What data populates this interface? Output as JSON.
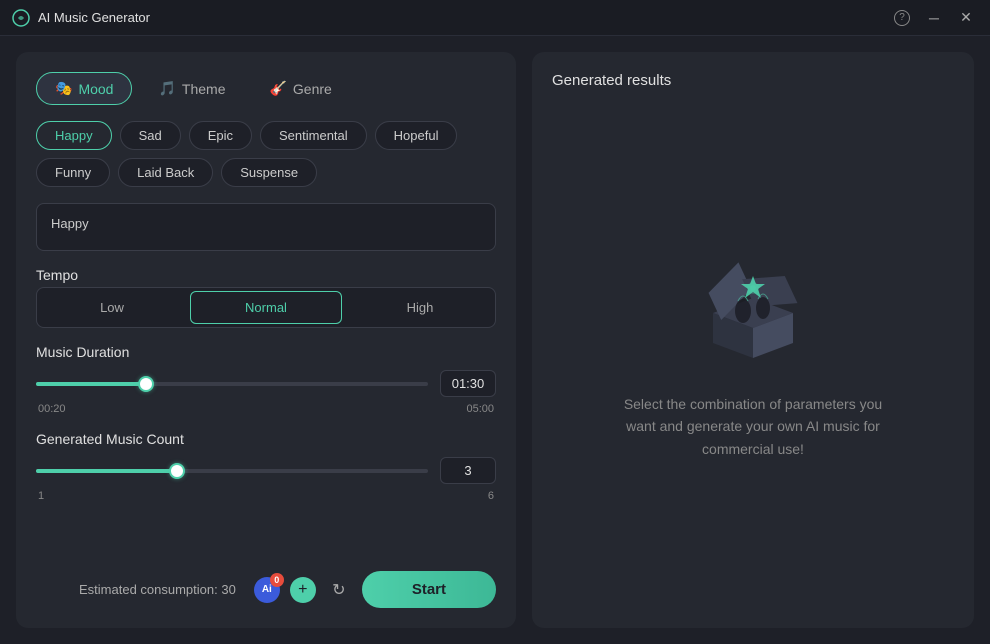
{
  "titlebar": {
    "title": "AI Music Generator",
    "help_label": "?",
    "minimize_icon": "─",
    "close_icon": "✕"
  },
  "tabs": [
    {
      "id": "mood",
      "label": "Mood",
      "icon": "🎭",
      "active": true
    },
    {
      "id": "theme",
      "label": "Theme",
      "icon": "🎵",
      "active": false
    },
    {
      "id": "genre",
      "label": "Genre",
      "icon": "🎸",
      "active": false
    }
  ],
  "moods": [
    {
      "id": "happy",
      "label": "Happy",
      "selected": true
    },
    {
      "id": "sad",
      "label": "Sad",
      "selected": false
    },
    {
      "id": "epic",
      "label": "Epic",
      "selected": false
    },
    {
      "id": "sentimental",
      "label": "Sentimental",
      "selected": false
    },
    {
      "id": "hopeful",
      "label": "Hopeful",
      "selected": false
    },
    {
      "id": "funny",
      "label": "Funny",
      "selected": false
    },
    {
      "id": "laid-back",
      "label": "Laid Back",
      "selected": false
    },
    {
      "id": "suspense",
      "label": "Suspense",
      "selected": false
    }
  ],
  "mood_text": {
    "value": "Happy"
  },
  "tempo": {
    "label": "Tempo",
    "options": [
      {
        "id": "low",
        "label": "Low",
        "active": false
      },
      {
        "id": "normal",
        "label": "Normal",
        "active": true
      },
      {
        "id": "high",
        "label": "High",
        "active": false
      }
    ]
  },
  "music_duration": {
    "label": "Music Duration",
    "min": "00:20",
    "max": "05:00",
    "value": "01:30",
    "fill_percent": 28
  },
  "music_count": {
    "label": "Generated Music Count",
    "min": "1",
    "max": "6",
    "value": "3",
    "fill_percent": 36
  },
  "bottom": {
    "consumption_label": "Estimated consumption: 30",
    "ai_label": "Ai",
    "count_badge": "0",
    "start_label": "Start"
  },
  "right_panel": {
    "title": "Generated results",
    "empty_text": "Select the combination of parameters you want and generate your own AI music for commercial use!"
  }
}
